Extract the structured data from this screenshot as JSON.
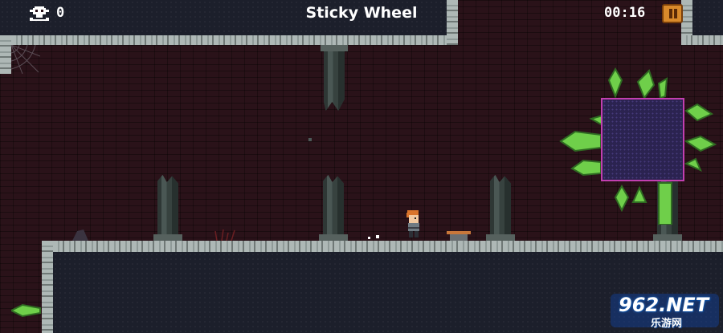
{
  "hud": {
    "death_count": "0",
    "level_title": "Sticky Wheel",
    "timer": "00:16"
  },
  "icons": {
    "deaths": "skull-icon",
    "pause": "pause-icon"
  },
  "colors": {
    "background_brick": "#2a1219",
    "stone_border": "#aeb8b6",
    "dark_rock": "#1c1f2b",
    "crystal_green": "#6fcf4a",
    "crystal_block_border": "#c23fb0",
    "crystal_block_fill": "#2b2350",
    "pause_button": "#d98a2b",
    "player_hair": "#d9742b"
  },
  "watermark": {
    "text": "962.NET",
    "subtext": "乐游网"
  }
}
